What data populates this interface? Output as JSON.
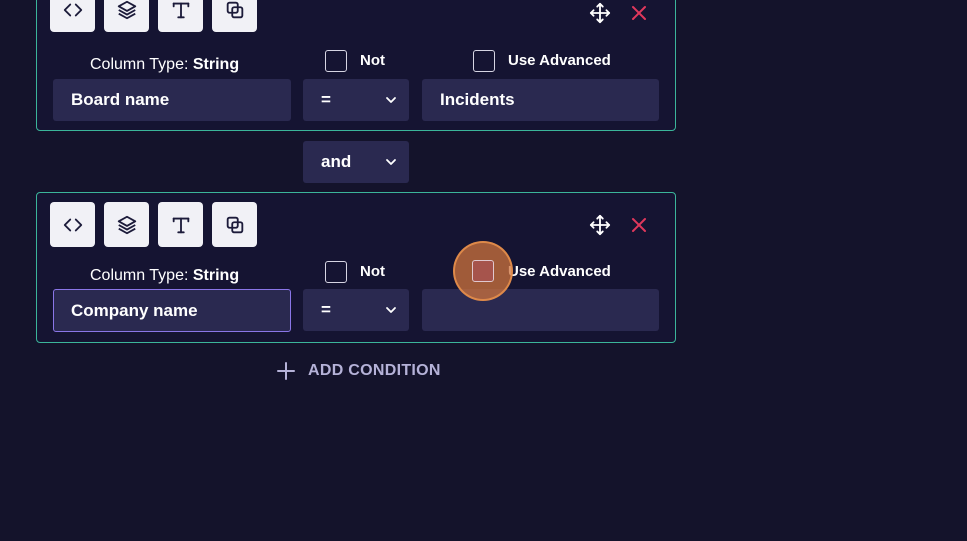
{
  "conditions": [
    {
      "column_type_prefix": "Column Type:",
      "column_type_value": "String",
      "not_label": "Not",
      "use_advanced_label": "Use Advanced",
      "column_name": "Board name",
      "operator": "=",
      "value": "Incidents"
    },
    {
      "column_type_prefix": "Column Type:",
      "column_type_value": "String",
      "not_label": "Not",
      "use_advanced_label": "Use Advanced",
      "column_name": "Company name",
      "operator": "=",
      "value": ""
    }
  ],
  "connector": {
    "label": "and"
  },
  "add_condition": {
    "label": "ADD CONDITION"
  },
  "toolbar_icons": [
    "code-icon",
    "layers-icon",
    "text-icon",
    "copy-icon"
  ],
  "colors": {
    "background": "#14132b",
    "card_border": "#3bb59a",
    "field_bg": "#2a2950",
    "close_red": "#e0385c",
    "focus_border": "#8a76e8",
    "add_condition_text": "#b5b2d8"
  }
}
